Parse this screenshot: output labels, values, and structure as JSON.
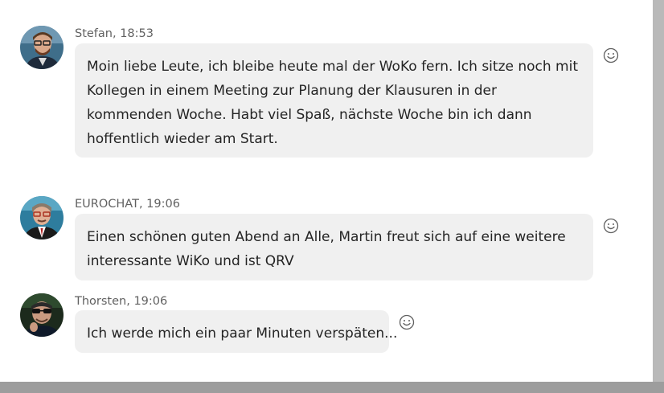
{
  "messages": [
    {
      "author": "Stefan",
      "time": "18:53",
      "meta": "Stefan, 18:53",
      "text": "Moin liebe Leute, ich bleibe heute mal der WoKo fern. Ich sitze noch mit Kollegen in einem Meeting zur Planung der Klausuren in der kommenden Woche. Habt viel Spaß, nächste Woche bin ich dann hoffentlich wieder am Start."
    },
    {
      "author": "EUROCHAT",
      "time": "19:06",
      "meta": "EUROCHAT, 19:06",
      "text": "Einen schönen guten Abend an Alle, Martin freut sich auf eine weitere interessante WiKo und ist QRV"
    },
    {
      "author": "Thorsten",
      "time": "19:06",
      "meta": "Thorsten, 19:06",
      "text": "Ich werde mich ein paar Minuten verspäten..."
    }
  ],
  "icons": {
    "reaction": "smiley-icon",
    "avatar": "avatar"
  },
  "colors": {
    "bubble": "#f0f0f0",
    "meta": "#616161",
    "text": "#242424"
  }
}
